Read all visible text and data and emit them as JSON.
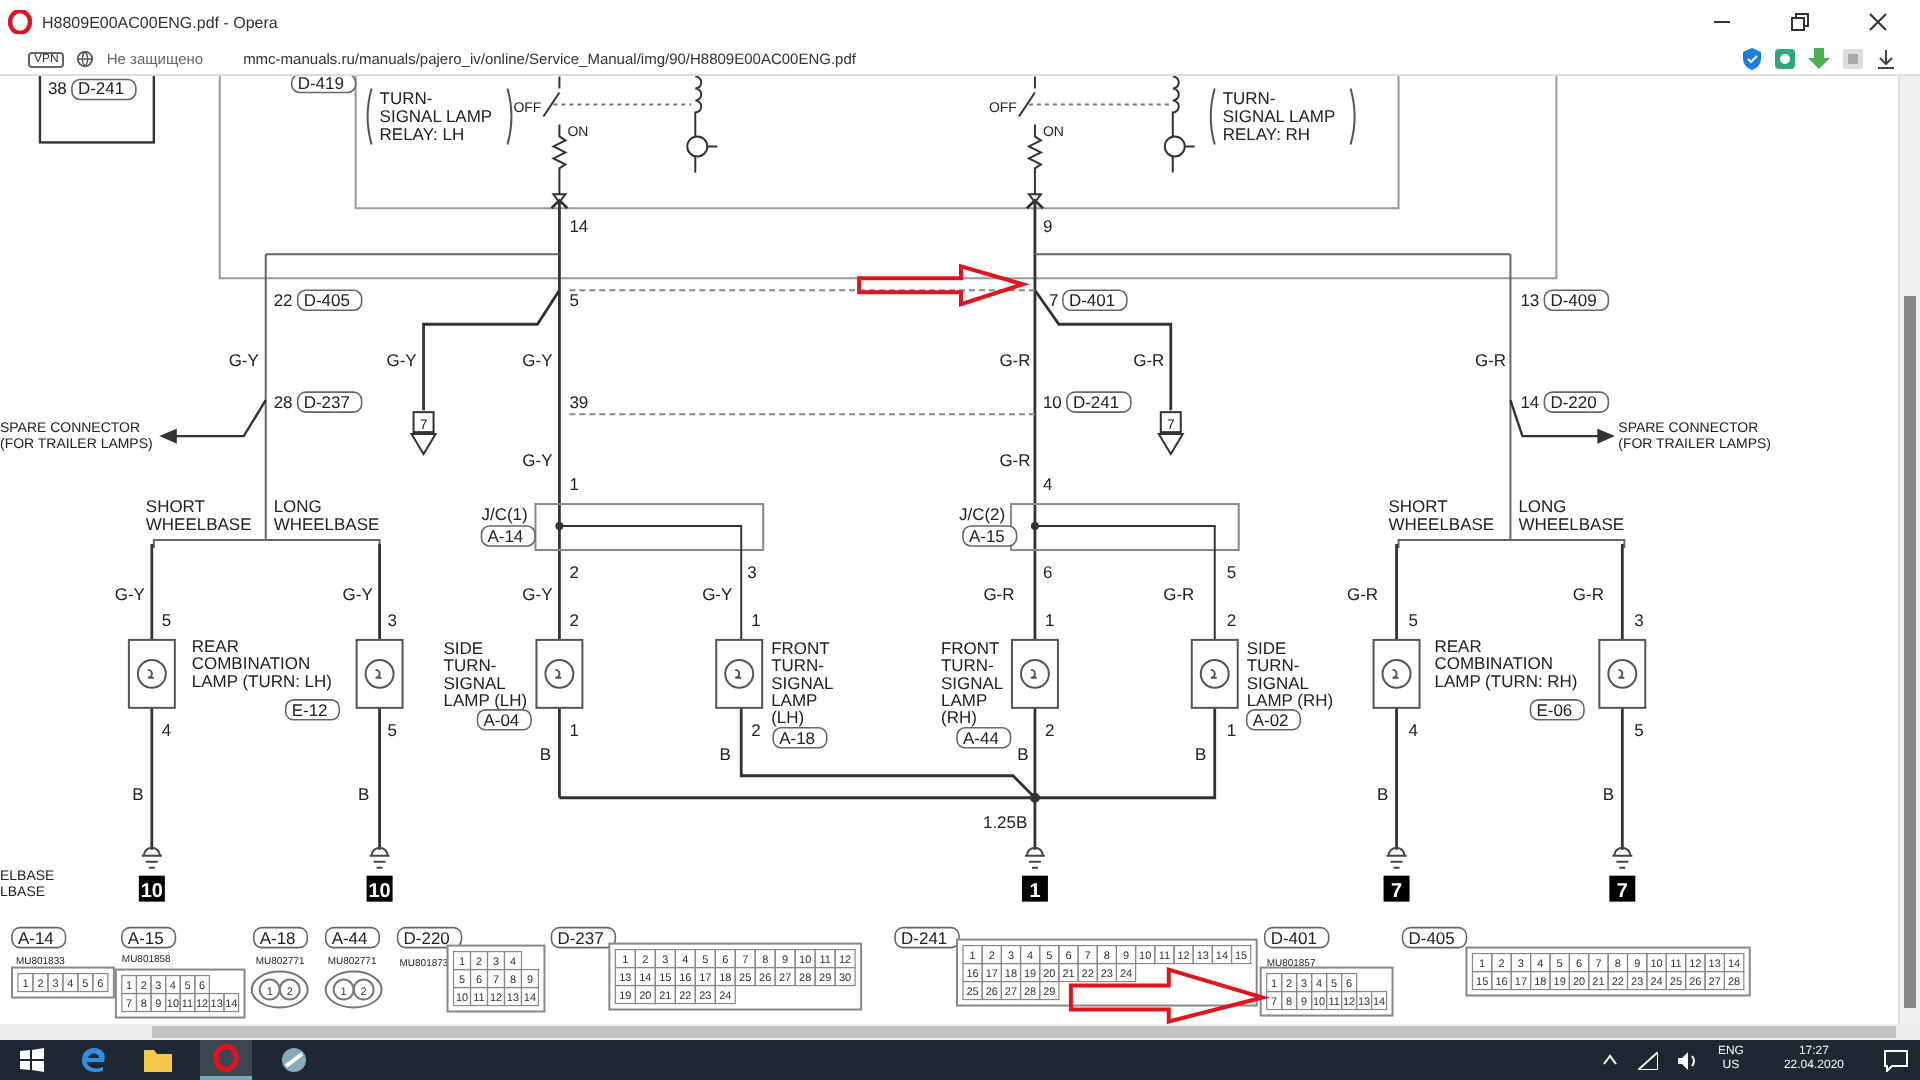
{
  "window": {
    "title": "H8809E00AC00ENG.pdf - Opera"
  },
  "address_bar": {
    "vpn": "VPN",
    "security": "Не защищено",
    "url": "mmc-manuals.ru/manuals/pajero_iv/online/Service_Manual/img/90/H8809E00AC00ENG.pdf"
  },
  "diagram": {
    "top_left": {
      "pin": "38",
      "tag": "D-241"
    },
    "cut_tag": "D-419",
    "relays": [
      {
        "lines": [
          "TURN-",
          "SIGNAL LAMP",
          "RELAY: LH"
        ],
        "off": "OFF",
        "on": "ON"
      },
      {
        "lines": [
          "TURN-",
          "SIGNAL LAMP",
          "RELAY: RH"
        ],
        "off": "OFF",
        "on": "ON"
      }
    ],
    "pins": [
      "14",
      "9",
      "5",
      "39",
      "1",
      "4",
      "2",
      "3",
      "6",
      "5",
      "5",
      "3",
      "2",
      "1",
      "1",
      "2",
      "5",
      "3",
      "4",
      "5",
      "1",
      "2",
      "2",
      "1",
      "4",
      "5"
    ],
    "connectors": [
      {
        "pin": "22",
        "tag": "D-405"
      },
      {
        "pin": "28",
        "tag": "D-237"
      },
      {
        "pin": "7",
        "tag": "D-401"
      },
      {
        "pin": "10",
        "tag": "D-241"
      },
      {
        "pin": "13",
        "tag": "D-409"
      },
      {
        "pin": "14",
        "tag": "D-220"
      }
    ],
    "wire_colors": [
      "G-Y",
      "G-Y",
      "G-Y",
      "G-Y",
      "G-R",
      "G-R",
      "G-R",
      "G-R",
      "G-Y",
      "G-Y",
      "G-Y",
      "G-Y",
      "G-R",
      "G-R",
      "G-R",
      "G-R",
      "B",
      "B",
      "B",
      "B",
      "B",
      "B",
      "B",
      "B"
    ],
    "spare_connectors": [
      {
        "lines": [
          "SPARE CONNECTOR",
          "(FOR TRAILER LAMPS)"
        ]
      },
      {
        "lines": [
          "SPARE CONNECTOR",
          "(FOR TRAILER LAMPS)"
        ]
      }
    ],
    "junctions": [
      {
        "name": "J/C(1)",
        "tag": "A-14"
      },
      {
        "name": "J/C(2)",
        "tag": "A-15"
      }
    ],
    "wheelbase": [
      {
        "short": [
          "SHORT",
          "WHEELBASE"
        ],
        "long": [
          "LONG",
          "WHEELBASE"
        ]
      },
      {
        "short": [
          "SHORT",
          "WHEELBASE"
        ],
        "long": [
          "LONG",
          "WHEELBASE"
        ]
      }
    ],
    "components": [
      {
        "lines": [
          "REAR",
          "COMBINATION",
          "LAMP (TURN: LH)"
        ],
        "tag": "E-12"
      },
      {
        "lines": [
          "SIDE",
          "TURN-",
          "SIGNAL",
          "LAMP (LH)"
        ],
        "tag": "A-04"
      },
      {
        "lines": [
          "FRONT",
          "TURN-",
          "SIGNAL",
          "LAMP",
          "(LH)"
        ],
        "tag": "A-18"
      },
      {
        "lines": [
          "FRONT",
          "TURN-",
          "SIGNAL",
          "LAMP",
          "(RH)"
        ],
        "tag": "A-44"
      },
      {
        "lines": [
          "SIDE",
          "TURN-",
          "SIGNAL",
          "LAMP (RH)"
        ],
        "tag": "A-02"
      },
      {
        "lines": [
          "REAR",
          "COMBINATION",
          "LAMP (TURN: RH)"
        ],
        "tag": "E-06"
      }
    ],
    "wire_size": "1.25B",
    "references": [
      "7",
      "7"
    ],
    "grounds": [
      "10",
      "10",
      "1",
      "7",
      "7"
    ],
    "cut_text": [
      "ELBASE",
      "LBASE"
    ],
    "connector_views": [
      {
        "kind": "grid",
        "tag": "A-14",
        "part": "MU801833",
        "rows": [
          [
            "1",
            "2",
            "3",
            "4",
            "5",
            "6"
          ]
        ]
      },
      {
        "kind": "grid",
        "tag": "A-15",
        "part": "MU801858",
        "rows": [
          [
            "1",
            "2",
            "3",
            "4",
            "5",
            "6"
          ],
          [
            "7",
            "8",
            "9",
            "10",
            "11",
            "12",
            "13",
            "14"
          ]
        ]
      },
      {
        "kind": "oval",
        "tag": "A-18",
        "part": "MU802771",
        "rows": [
          [
            "1",
            "2"
          ]
        ]
      },
      {
        "kind": "oval",
        "tag": "A-44",
        "part": "MU802771",
        "rows": [
          [
            "1",
            "2"
          ]
        ]
      },
      {
        "kind": "grid",
        "tag": "D-220",
        "part": "MU801873",
        "rows": [
          [
            "1",
            "2",
            "3",
            "4"
          ],
          [
            "5",
            "6",
            "7",
            "8",
            "9"
          ],
          [
            "10",
            "11",
            "12",
            "13",
            "14"
          ]
        ]
      },
      {
        "kind": "grid",
        "tag": "D-237",
        "rows": [
          [
            "1",
            "2",
            "3",
            "4",
            "5",
            "6",
            "7",
            "8",
            "9",
            "10",
            "11",
            "12"
          ],
          [
            "13",
            "14",
            "15",
            "16",
            "17",
            "18",
            "25",
            "26",
            "27",
            "28",
            "29",
            "30"
          ],
          [
            "19",
            "20",
            "21",
            "22",
            "23",
            "24"
          ]
        ]
      },
      {
        "kind": "grid",
        "tag": "D-241",
        "rows": [
          [
            "1",
            "2",
            "3",
            "4",
            "5",
            "6",
            "7",
            "8",
            "9",
            "10",
            "11",
            "12",
            "13",
            "14",
            "15"
          ],
          [
            "16",
            "17",
            "18",
            "19",
            "20",
            "21",
            "22",
            "23",
            "24"
          ],
          [
            "25",
            "26",
            "27",
            "28",
            "29"
          ]
        ]
      },
      {
        "kind": "grid",
        "tag": "D-401",
        "part": "MU801857",
        "rows": [
          [
            "1",
            "2",
            "3",
            "4",
            "5",
            "6"
          ],
          [
            "7",
            "8",
            "9",
            "10",
            "11",
            "12",
            "13",
            "14"
          ]
        ]
      },
      {
        "kind": "grid",
        "tag": "D-405",
        "rows": [
          [
            "1",
            "2",
            "3",
            "4",
            "5",
            "6",
            "7",
            "8",
            "9",
            "10",
            "11",
            "12",
            "13",
            "14"
          ],
          [
            "15",
            "16",
            "17",
            "18",
            "19",
            "20",
            "21",
            "22",
            "23",
            "24",
            "25",
            "26",
            "27",
            "28"
          ]
        ]
      }
    ]
  },
  "taskbar": {
    "language": "ENG",
    "layout": "US",
    "time": "17:27",
    "date": "22.04.2020"
  }
}
